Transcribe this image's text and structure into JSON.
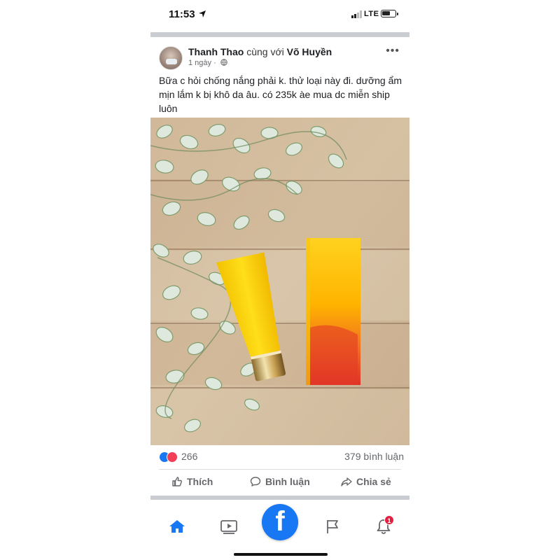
{
  "status_bar": {
    "time": "11:53",
    "network": "LTE",
    "icons": [
      "location-arrow-icon",
      "signal-bars-icon",
      "battery-icon"
    ]
  },
  "post": {
    "author": "Thanh Thao",
    "with_text": "cùng với",
    "tagged": "Võ Huyền",
    "time": "1 ngày",
    "privacy_icon": "globe-icon",
    "more_label": "•••",
    "text": "Bữa c hỏi chống nắng phải k. thử loại này đi. dưỡng ẩm mịn lắm k bị khô da âu. có 235k àe mua dc miễn ship luôn"
  },
  "reactions": {
    "count": "266",
    "comments": "379 bình luận",
    "icons": [
      "like-icon",
      "love-icon"
    ]
  },
  "actions": {
    "like": "Thích",
    "comment": "Bình luận",
    "share": "Chia sẻ"
  },
  "bottom_nav": {
    "notification_badge": "1",
    "logo": "f"
  },
  "colors": {
    "facebook_blue": "#1877f2",
    "love_red": "#f33e58",
    "badge_red": "#e41e3f",
    "divider": "#c9ccd1"
  }
}
